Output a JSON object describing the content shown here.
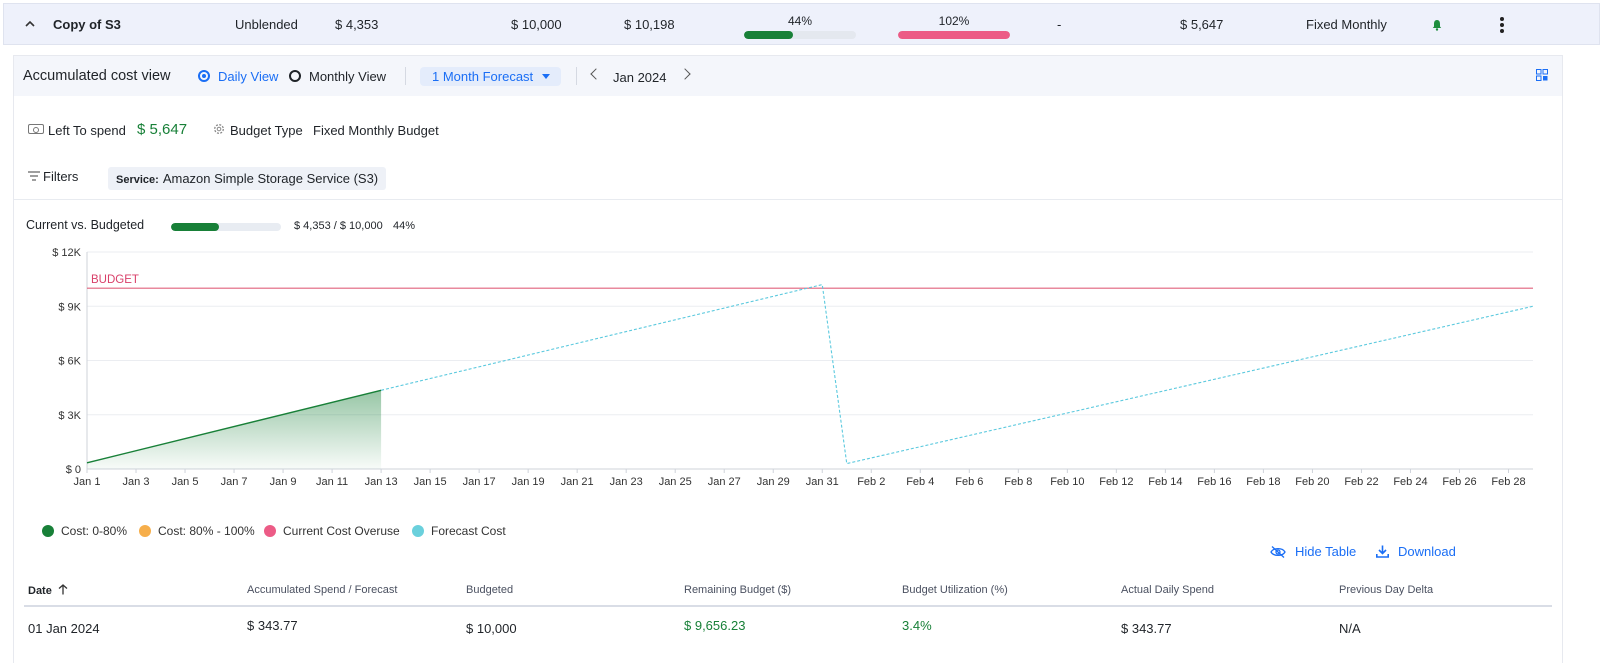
{
  "budget_row": {
    "name": "Copy of S3",
    "cost_type": "Unblended",
    "current_spend": "$ 4,353",
    "budget": "$ 10,000",
    "forecast": "$ 10,198",
    "spend_pct_label": "44%",
    "spend_pct_value": 44,
    "forecast_pct_label": "102%",
    "forecast_pct_value": 102,
    "delta": "-",
    "left_to_spend": "$ 5,647",
    "budget_type": "Fixed Monthly",
    "colors": {
      "spend_bar": "#188038",
      "forecast_bar": "#ec5b86",
      "bell": "#1e8e3e"
    }
  },
  "panel": {
    "title": "Accumulated cost view",
    "view_options": [
      "Daily View",
      "Monthly View"
    ],
    "selected_view": "Daily View",
    "forecast_dropdown": "1 Month Forecast",
    "period": "Jan 2024"
  },
  "summary": {
    "left_to_spend_label": "Left To spend",
    "left_to_spend_value": "$ 5,647",
    "budget_type_label": "Budget Type",
    "budget_type_value": "Fixed Monthly Budget"
  },
  "filters": {
    "label": "Filters",
    "chip_key": "Service:",
    "chip_value": "Amazon Simple Storage Service (S3)"
  },
  "current_vs_budgeted": {
    "label": "Current vs. Budgeted",
    "value": "$ 4,353 / $ 10,000",
    "pct_label": "44%",
    "pct": 44
  },
  "chart_data": {
    "type": "area",
    "budget_label": "BUDGET",
    "budget_value": 10000,
    "x_ticks": [
      "Jan 1",
      "Jan 3",
      "Jan 5",
      "Jan 7",
      "Jan 9",
      "Jan 11",
      "Jan 13",
      "Jan 15",
      "Jan 17",
      "Jan 19",
      "Jan 21",
      "Jan 23",
      "Jan 25",
      "Jan 27",
      "Jan 29",
      "Jan 31",
      "Feb 2",
      "Feb 4",
      "Feb 6",
      "Feb 8",
      "Feb 10",
      "Feb 12",
      "Feb 14",
      "Feb 16",
      "Feb 18",
      "Feb 20",
      "Feb 22",
      "Feb 24",
      "Feb 26",
      "Feb 28"
    ],
    "y_ticks": [
      "$ 0",
      "$ 3K",
      "$ 6K",
      "$ 9K",
      "$ 12K"
    ],
    "ylim": [
      0,
      12000
    ],
    "grid": true,
    "series": [
      {
        "name": "Cost: 0-80%",
        "color": "#188038",
        "x": [
          "Jan 1",
          "Jan 13"
        ],
        "values": [
          344,
          4353
        ]
      },
      {
        "name": "Forecast Cost",
        "color": "#5bc9de",
        "x": [
          "Jan 13",
          "Jan 31",
          "Feb 1",
          "Feb 29"
        ],
        "values": [
          4353,
          10198,
          300,
          9000
        ]
      }
    ],
    "legend": [
      {
        "name": "Cost: 0-80%",
        "color": "#188038"
      },
      {
        "name": "Cost: 80% - 100%",
        "color": "#f6ae4b"
      },
      {
        "name": "Current Cost Overuse",
        "color": "#ec5b86"
      },
      {
        "name": "Forecast Cost",
        "color": "#6ad0dc"
      }
    ]
  },
  "table_actions": {
    "hide_table": "Hide Table",
    "download": "Download"
  },
  "table": {
    "columns": [
      "Date",
      "Accumulated Spend / Forecast",
      "Budgeted",
      "Remaining Budget ($)",
      "Budget Utilization (%)",
      "Actual Daily Spend",
      "Previous Day Delta"
    ],
    "rows": [
      [
        "01 Jan 2024",
        "$ 343.77",
        "$ 10,000",
        "$ 9,656.23",
        "3.4%",
        "$ 343.77",
        "N/A"
      ]
    ]
  }
}
